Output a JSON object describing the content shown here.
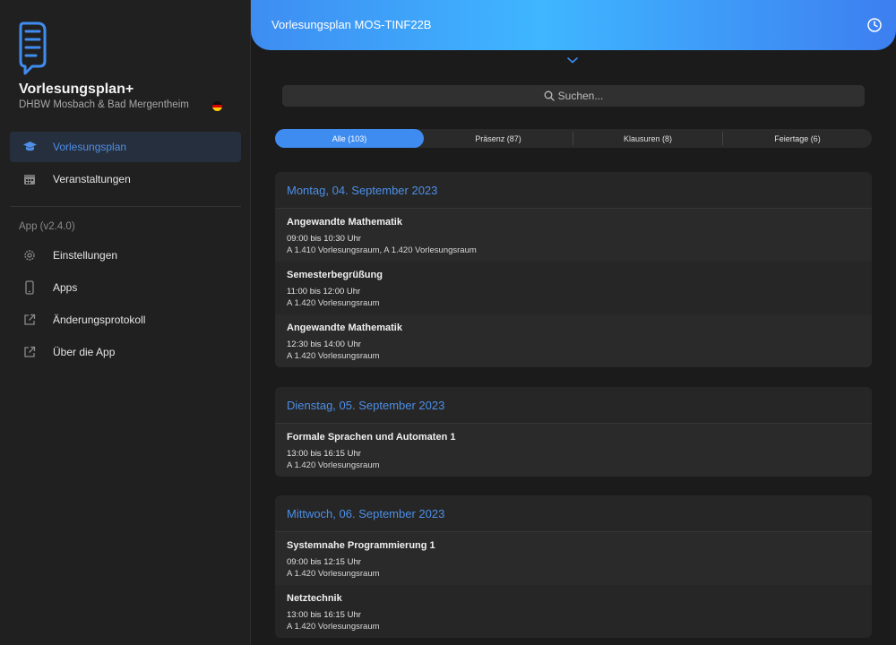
{
  "app": {
    "title": "Vorlesungsplan+",
    "subtitle": "DHBW Mosbach & Bad Mergentheim"
  },
  "nav": {
    "main": [
      {
        "label": "Vorlesungsplan",
        "icon": "graduation-cap-icon",
        "active": true
      },
      {
        "label": "Veranstaltungen",
        "icon": "calendar-icon",
        "active": false
      }
    ],
    "section_label": "App (v2.4.0)",
    "app_items": [
      {
        "label": "Einstellungen",
        "icon": "gear-icon"
      },
      {
        "label": "Apps",
        "icon": "phone-icon"
      },
      {
        "label": "Änderungsprotokoll",
        "icon": "external-link-icon"
      },
      {
        "label": "Über die App",
        "icon": "external-link-icon"
      }
    ]
  },
  "header": {
    "title": "Vorlesungsplan MOS-TINF22B"
  },
  "search": {
    "placeholder": "Suchen..."
  },
  "filters": [
    {
      "label": "Alle (103)",
      "active": true
    },
    {
      "label": "Präsenz (87)",
      "active": false
    },
    {
      "label": "Klausuren (8)",
      "active": false
    },
    {
      "label": "Feiertage (6)",
      "active": false
    }
  ],
  "days": [
    {
      "date": "Montag, 04. September 2023",
      "events": [
        {
          "title": "Angewandte Mathematik",
          "time": "09:00 bis 10:30 Uhr",
          "room": "A 1.410 Vorlesungsraum, A 1.420 Vorlesungsraum"
        },
        {
          "title": "Semesterbegrüßung",
          "time": "11:00 bis 12:00 Uhr",
          "room": "A 1.420 Vorlesungsraum"
        },
        {
          "title": "Angewandte Mathematik",
          "time": "12:30 bis 14:00 Uhr",
          "room": "A 1.420 Vorlesungsraum"
        }
      ]
    },
    {
      "date": "Dienstag, 05. September 2023",
      "events": [
        {
          "title": "Formale Sprachen und Automaten 1",
          "time": "13:00 bis 16:15 Uhr",
          "room": "A 1.420 Vorlesungsraum"
        }
      ]
    },
    {
      "date": "Mittwoch, 06. September 2023",
      "events": [
        {
          "title": "Systemnahe Programmierung 1",
          "time": "09:00 bis 12:15 Uhr",
          "room": "A 1.420 Vorlesungsraum"
        },
        {
          "title": "Netztechnik",
          "time": "13:00 bis 16:15 Uhr",
          "room": "A 1.420 Vorlesungsraum"
        }
      ]
    }
  ],
  "colors": {
    "accent": "#3f8cf0",
    "header_gradient_start": "#3e8df2",
    "header_gradient_mid": "#3fb6ff",
    "background": "#1b1b1b"
  }
}
